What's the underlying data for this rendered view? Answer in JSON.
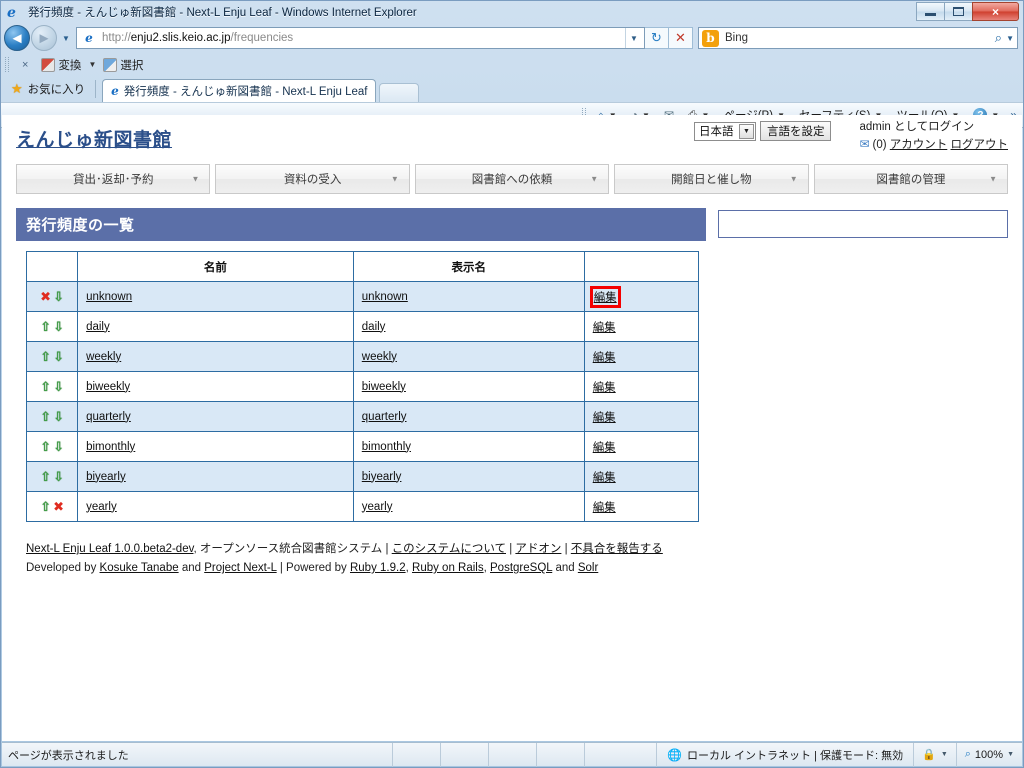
{
  "browser": {
    "window_title": "発行頻度 - えんじゅ新図書館 - Next-L Enju Leaf - Windows Internet Explorer",
    "address_url_scheme": "http://",
    "address_url_host": "enju2.slis.keio.ac.jp",
    "address_url_path": "/frequencies",
    "search_provider": "Bing",
    "search_icon": "bing-icon",
    "window_controls": {
      "minimize": "minimize-icon",
      "restore": "restore-icon",
      "close": "×"
    },
    "nav": {
      "back": "◄",
      "forward": "►",
      "history_caret": "▼",
      "refresh": "↻",
      "stop": "✕",
      "address_dropdown": "▼",
      "search_caret": "▼",
      "search_magnifier": "⌕"
    },
    "converter_toolbar": {
      "close_label": "×",
      "convert_label": "変換",
      "convert_caret": "▼",
      "select_label": "選択"
    },
    "favorites": {
      "label": "お気に入り",
      "star_icon": "star-icon"
    },
    "tab": {
      "title": "発行頻度 - えんじゅ新図書館 - Next-L Enju Leaf",
      "new_tab_label": ""
    },
    "command_bar": [
      {
        "label": "",
        "icon": "home-icon",
        "caret": "▼"
      },
      {
        "label": "",
        "icon": "rss-icon",
        "caret": "▼"
      },
      {
        "label": "",
        "icon": "mail-icon",
        "caret": ""
      },
      {
        "label": "",
        "icon": "print-icon",
        "caret": "▼"
      },
      {
        "label": "ページ(P)",
        "icon": "",
        "caret": "▼"
      },
      {
        "label": "セーフティ(S)",
        "icon": "",
        "caret": "▼"
      },
      {
        "label": "ツール(O)",
        "icon": "",
        "caret": "▼"
      },
      {
        "label": "",
        "icon": "help-icon",
        "caret": "▼"
      }
    ],
    "command_bar_more": "»"
  },
  "page": {
    "site_title": "えんじゅ新図書館",
    "language": {
      "selected": "日本語",
      "dropdown_caret": "▼",
      "set_button": "言語を設定"
    },
    "account": {
      "logged_in_text": "admin としてログイン",
      "message_icon": "envelope-icon",
      "message_count": "(0)",
      "account_link": "アカウント",
      "logout_link": "ログアウト"
    },
    "nav_menu": [
      {
        "label": "貸出･返却･予約",
        "caret": "▼"
      },
      {
        "label": "資料の受入",
        "caret": "▼"
      },
      {
        "label": "図書館への依頼",
        "caret": "▼"
      },
      {
        "label": "開館日と催し物",
        "caret": "▼"
      },
      {
        "label": "図書館の管理",
        "caret": "▼"
      }
    ],
    "panel_title": "発行頻度の一覧",
    "table": {
      "headers": [
        "",
        "名前",
        "表示名",
        ""
      ],
      "rows": [
        {
          "up": "",
          "down": "⇩",
          "delete": "✖",
          "name": "unknown",
          "display_name": "unknown",
          "edit": "編集",
          "highlighted": true
        },
        {
          "up": "⇧",
          "down": "⇩",
          "delete": "",
          "name": "daily",
          "display_name": "daily",
          "edit": "編集",
          "highlighted": false
        },
        {
          "up": "⇧",
          "down": "⇩",
          "delete": "",
          "name": "weekly",
          "display_name": "weekly",
          "edit": "編集",
          "highlighted": false
        },
        {
          "up": "⇧",
          "down": "⇩",
          "delete": "",
          "name": "biweekly",
          "display_name": "biweekly",
          "edit": "編集",
          "highlighted": false
        },
        {
          "up": "⇧",
          "down": "⇩",
          "delete": "",
          "name": "quarterly",
          "display_name": "quarterly",
          "edit": "編集",
          "highlighted": false
        },
        {
          "up": "⇧",
          "down": "⇩",
          "delete": "",
          "name": "bimonthly",
          "display_name": "bimonthly",
          "edit": "編集",
          "highlighted": false
        },
        {
          "up": "⇧",
          "down": "⇩",
          "delete": "",
          "name": "biyearly",
          "display_name": "biyearly",
          "edit": "編集",
          "highlighted": false
        },
        {
          "up": "⇧",
          "down": "",
          "delete": "✖",
          "name": "yearly",
          "display_name": "yearly",
          "edit": "編集",
          "highlighted": false
        }
      ]
    },
    "footer": {
      "app_link": "Next-L Enju Leaf 1.0.0.beta2-dev",
      "tagline": ", オープンソース統合図書館システム",
      "sep1": "|",
      "about_link": "このシステムについて",
      "sep2": "|",
      "addon_link": "アドオン",
      "sep3": "|",
      "bug_link": "不具合を報告する",
      "developed_by": "Developed by",
      "dev1": "Kosuke Tanabe",
      "and1": "and",
      "dev2": "Project Next-L",
      "sep4": "|",
      "powered_by": "Powered by",
      "tech1": "Ruby 1.9.2",
      "comma1": ",",
      "tech2": "Ruby on Rails",
      "comma2": ",",
      "tech3": "PostgreSQL",
      "and2": "and",
      "tech4": "Solr"
    }
  },
  "statusbar": {
    "message": "ページが表示されました",
    "zone_icon": "globe-icon",
    "zone": "ローカル イントラネット | 保護モード: 無効",
    "lock_icon": "lock-icon",
    "lock_caret": "▼",
    "zoom_icon": "zoom-icon",
    "zoom_level": "100%",
    "zoom_caret": "▼"
  },
  "colors": {
    "panel_blue": "#5b6fa8",
    "row_alt": "#d9e8f6",
    "table_border": "#2d6ca2",
    "highlight_red": "#f40000",
    "arrow_green": "#3f9d45",
    "site_title": "#2b4f8a"
  }
}
